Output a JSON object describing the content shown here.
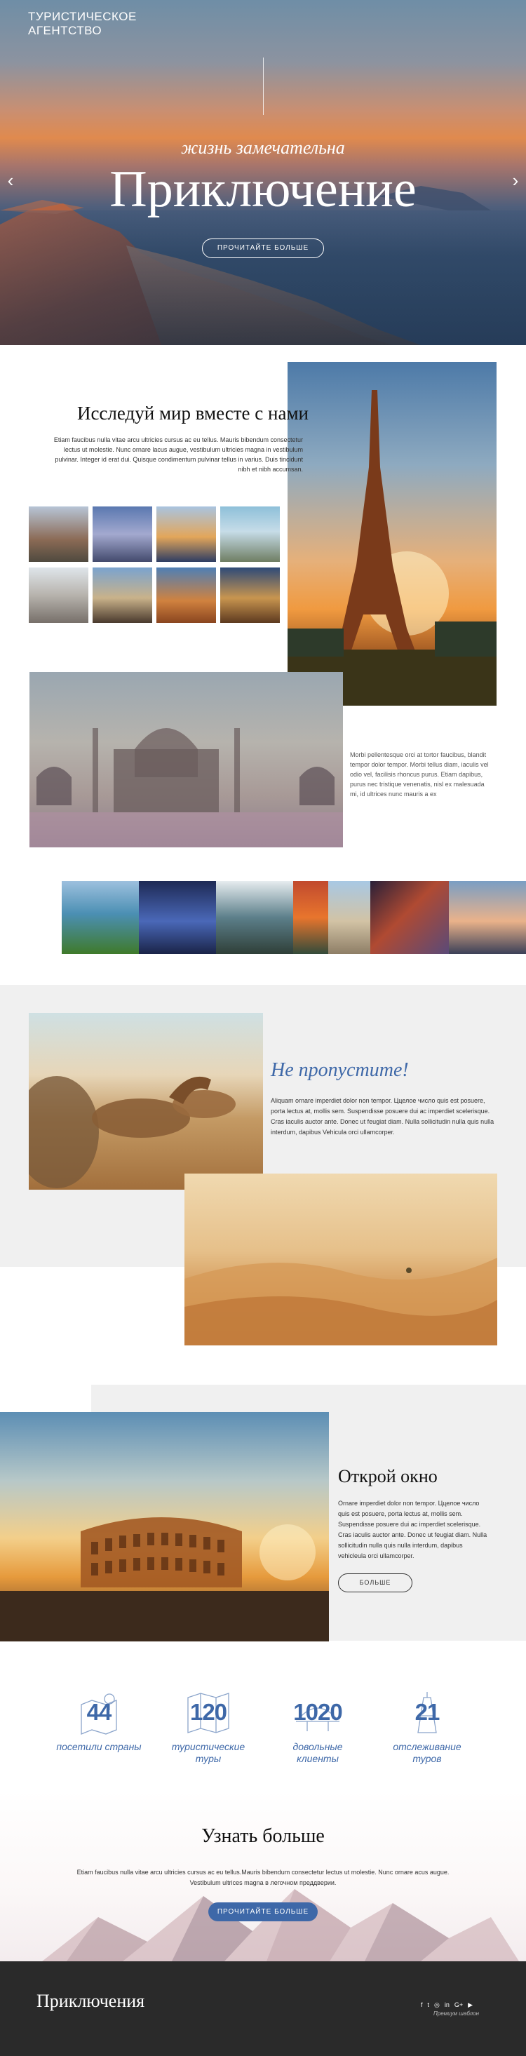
{
  "header": {
    "brand": "ТУРИСТИЧЕСКОЕ АГЕНТСТВО"
  },
  "hero": {
    "subtitle": "жизнь замечательна",
    "title": "Приключение",
    "button": "ПРОЧИТАЙТЕ БОЛЬШЕ",
    "prev_icon": "chevron-left-icon",
    "next_icon": "chevron-right-icon",
    "slides_total": 4,
    "active_slide": 1
  },
  "explore": {
    "title": "Исследуй мир вместе с нами",
    "text": "Etiam faucibus nulla vitae arcu ultricies cursus ac eu tellus. Mauris bibendum consectetur lectus ut molestie. Nunc ornare lacus augue, vestibulum ultricies magna in vestibulum pulvinar. Integer id erat dui. Quisque condimentum pulvinar tellus in varius. Duis tincidunt nibh et nibh accumsan."
  },
  "taj": {
    "text": "Morbi pellentesque orci at tortor faucibus, blandit tempor dolor tempor. Morbi tellus diam, iaculis vel odio vel, facilisis rhoncus purus. Etiam dapibus, purus nec tristique venenatis, nisl ex malesuada mi, id ultrices nunc mauris a ex"
  },
  "dont_miss": {
    "title": "Не пропустите!",
    "text": "Aliquam ornare imperdiet dolor non tempor. Ццелое число quis est posuere, porta lectus at, mollis sem. Suspendisse posuere dui ac imperdiet scelerisque. Cras iaculis auctor ante. Donec ut feugiat diam. Nulla sollicitudin nulla quis nulla interdum, dapibus Vehicula orci ullamcorper."
  },
  "open_window": {
    "title": "Открой окно",
    "text": "Ornare imperdiet dolor non tempor. Ццелое число quis est posuere, porta lectus at, mollis sem. Suspendisse posuere dui ac imperdiet scelerisque. Cras iaculis auctor ante. Donec ut feugiat diam. Nulla sollicitudin nulla quis nulla interdum, dapibus vehicleula orci ullamcorper.",
    "button": "БОЛЬШЕ"
  },
  "stats": [
    {
      "number": "44",
      "label": "посетили страны",
      "icon": "map-pin-icon"
    },
    {
      "number": "120",
      "label": "туристические туры",
      "icon": "map-icon"
    },
    {
      "number": "1020",
      "label": "довольные клиенты",
      "icon": "happy-clients-icon"
    },
    {
      "number": "21",
      "label": "отслеживание туров",
      "icon": "tower-icon"
    }
  ],
  "learn_more": {
    "title": "Узнать больше",
    "text": "Etiam faucibus nulla vitae arcu ultricies cursus ac eu tellus.Mauris bibendum consectetur lectus ut molestie. Nunc ornare acus augue. Vestibulum ultrices magna в легочном преддверии.",
    "button": "ПРОЧИТАЙТЕ БОЛЬШЕ"
  },
  "footer": {
    "brand": "Приключения",
    "social": [
      "f",
      "t",
      "◎",
      "in",
      "G+",
      "▶"
    ],
    "note": "Премиум шаблон"
  },
  "colors": {
    "accent": "#3e68a8",
    "footer": "#2a2a2a",
    "section_gray": "#f0f0f0"
  }
}
